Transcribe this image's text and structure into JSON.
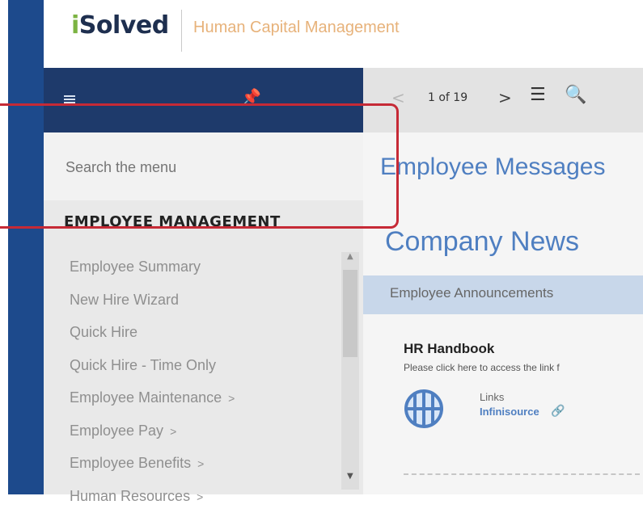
{
  "brand": {
    "logo_i": "i",
    "logo_rest": "Solved",
    "app_name": "Human Capital Management"
  },
  "menu": {
    "search_placeholder": "Search the menu",
    "section_title": "EMPLOYEE MANAGEMENT",
    "items": [
      {
        "label": "Employee Summary",
        "submenu": false
      },
      {
        "label": "New Hire Wizard",
        "submenu": false
      },
      {
        "label": "Quick Hire",
        "submenu": false
      },
      {
        "label": "Quick Hire - Time Only",
        "submenu": false
      },
      {
        "label": "Employee Maintenance",
        "submenu": true
      },
      {
        "label": "Employee Pay",
        "submenu": true
      },
      {
        "label": "Employee Benefits",
        "submenu": true
      },
      {
        "label": "Human Resources",
        "submenu": true
      }
    ],
    "submenu_chevron": ">"
  },
  "toolbar": {
    "page_indicator": "1 of 19",
    "prev_icon": "<",
    "next_icon": ">"
  },
  "content": {
    "title": "Employee Messages",
    "company_news": "Company News",
    "announcements_label": "Employee Announcements",
    "hr_title": "HR Handbook",
    "hr_desc": "Please click here to access the link f",
    "links_label": "Links",
    "link_text": "Infinisource"
  },
  "colors": {
    "nav_blue": "#1d4a8c",
    "menu_header": "#1e3a6b",
    "accent_blue": "#4f7fc1",
    "highlight_red": "#c62a36"
  }
}
